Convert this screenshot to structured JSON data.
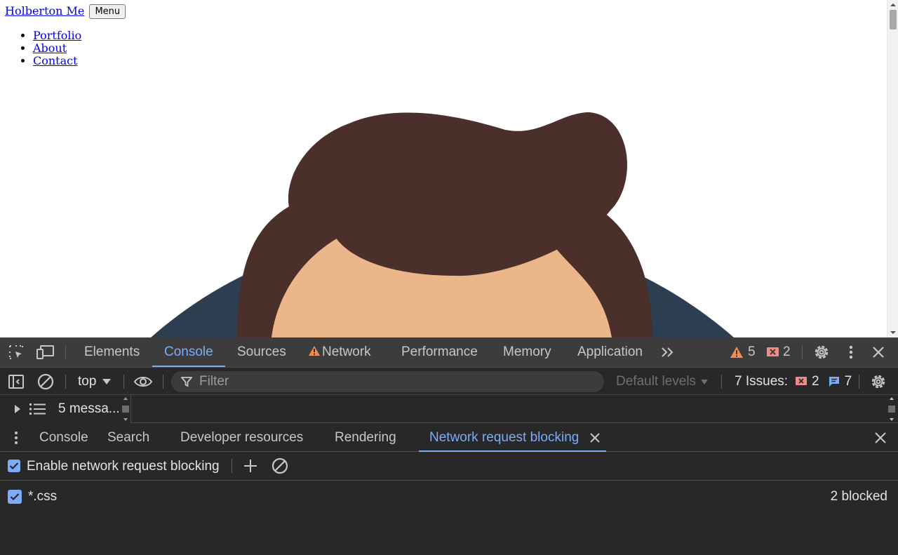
{
  "page": {
    "site_link": "Holberton Me",
    "menu_button": "Menu",
    "nav_items": [
      "Portfolio",
      "About",
      "Contact"
    ]
  },
  "devtools": {
    "main_tabs": [
      "Elements",
      "Console",
      "Sources",
      "Network",
      "Performance",
      "Memory",
      "Application"
    ],
    "active_tab": "Console",
    "warning_count": "5",
    "error_count": "2",
    "context_selector": "top",
    "filter_placeholder": "Filter",
    "levels_dropdown": "Default levels",
    "issues_label": "7 Issues:",
    "issues_errors": "2",
    "issues_info": "7",
    "sidebar_messages": "5 messa...",
    "drawer_tabs": [
      "Console",
      "Search",
      "Developer resources",
      "Rendering",
      "Network request blocking"
    ],
    "active_drawer_tab": "Network request blocking",
    "enable_blocking_label": "Enable network request blocking",
    "enable_blocking_checked": true,
    "blocked_patterns": [
      {
        "pattern": "*.css",
        "checked": true,
        "status": "2 blocked"
      }
    ],
    "colors": {
      "accent": "#7cacf8",
      "warning": "#f28b54",
      "error": "#f28b82",
      "panel_bg": "#282828",
      "toolbar_bg": "#3c3c3c"
    }
  }
}
